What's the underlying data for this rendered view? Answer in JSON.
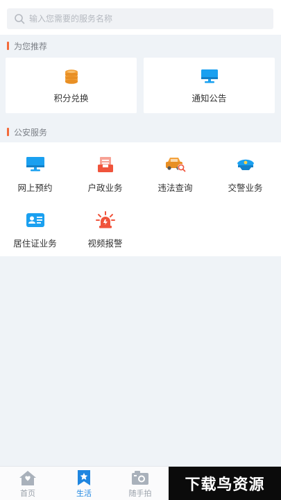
{
  "search": {
    "placeholder": "输入您需要的服务名称"
  },
  "recommend": {
    "title": "为您推荐",
    "items": [
      {
        "label": "积分兑换",
        "icon": "coins-icon"
      },
      {
        "label": "通知公告",
        "icon": "monitor-icon"
      }
    ]
  },
  "police": {
    "title": "公安服务",
    "items": [
      {
        "label": "网上预约",
        "icon": "monitor-icon"
      },
      {
        "label": "户政业务",
        "icon": "document-tray-icon"
      },
      {
        "label": "违法查询",
        "icon": "car-search-icon"
      },
      {
        "label": "交警业务",
        "icon": "police-cap-icon"
      },
      {
        "label": "居住证业务",
        "icon": "id-card-icon"
      },
      {
        "label": "视频报警",
        "icon": "alarm-light-icon"
      }
    ]
  },
  "tabbar": {
    "items": [
      {
        "label": "首页",
        "icon": "home-icon"
      },
      {
        "label": "生活",
        "icon": "bookmark-star-icon",
        "active": true
      },
      {
        "label": "随手拍",
        "icon": "camera-icon"
      }
    ]
  },
  "watermark": {
    "text": "下载鸟资源"
  },
  "colors": {
    "accent": "#1f86e0",
    "section_bar": "#f36a3a",
    "orange": "#f3a13a",
    "red": "#f0543c",
    "blue": "#1aa0f0"
  }
}
